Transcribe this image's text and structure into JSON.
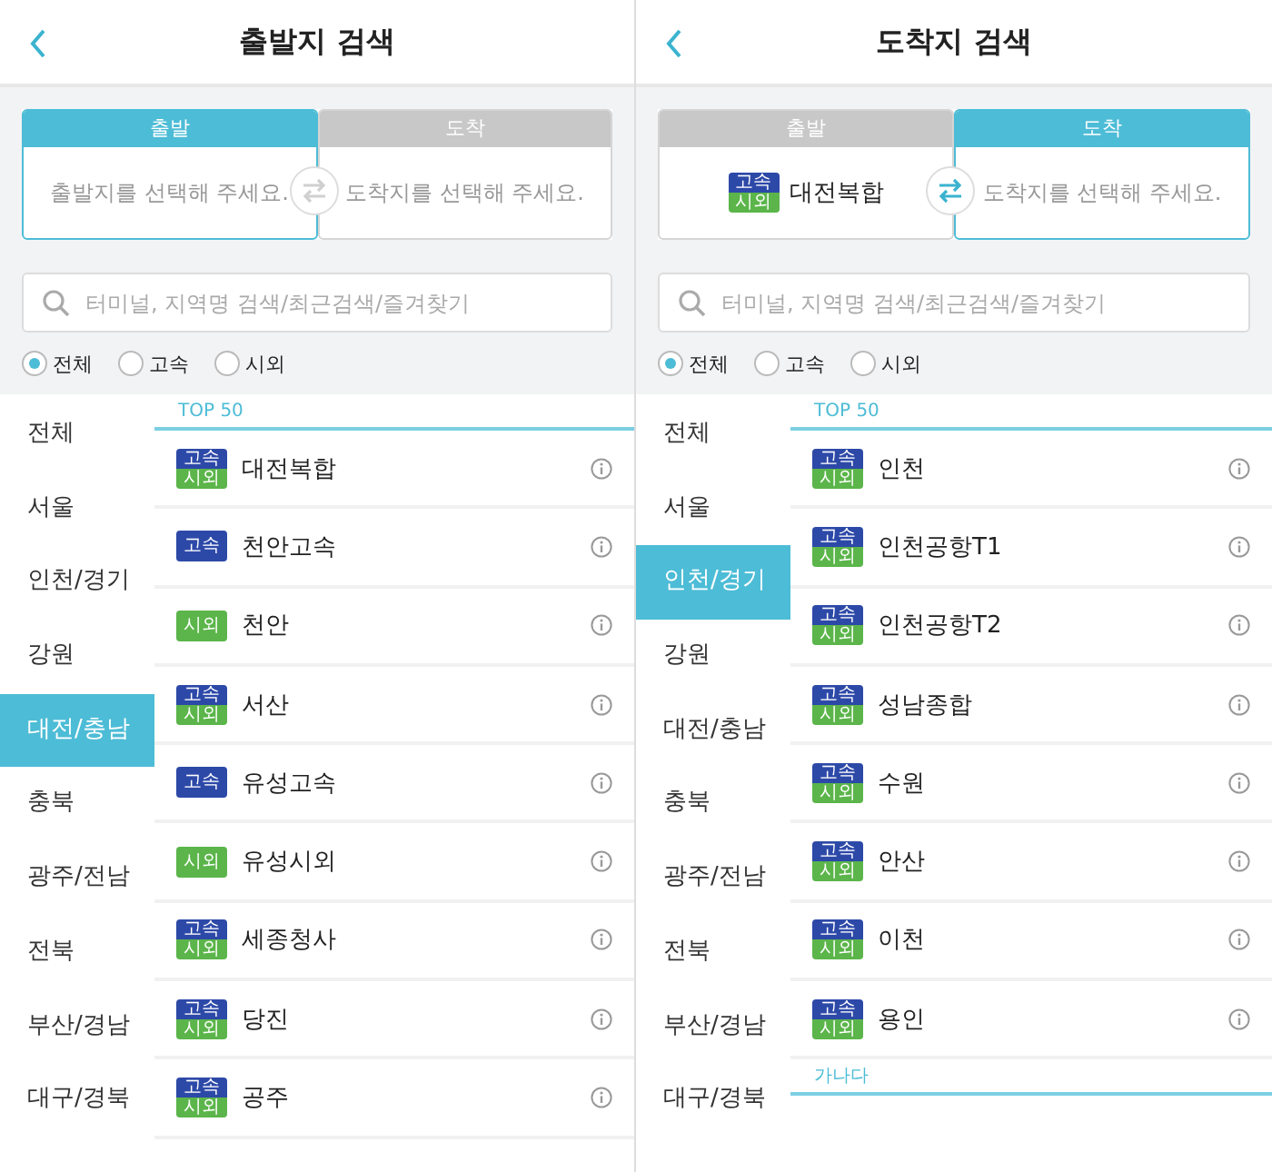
{
  "screens": [
    {
      "title": "출발지 검색",
      "swap_active": false,
      "slots": [
        {
          "header": "출발",
          "selected": true,
          "placeholder": "출발지를 선택해 주세요."
        },
        {
          "header": "도착",
          "selected": false,
          "placeholder": "도착지를 선택해 주세요."
        }
      ],
      "search": {
        "placeholder": "터미널, 지역명 검색/최근검색/즐겨찾기"
      },
      "filters": [
        {
          "label": "전체",
          "selected": true
        },
        {
          "label": "고속",
          "selected": false
        },
        {
          "label": "시외",
          "selected": false
        }
      ],
      "regions": [
        {
          "label": "전체",
          "selected": false
        },
        {
          "label": "서울",
          "selected": false
        },
        {
          "label": "인천/경기",
          "selected": false
        },
        {
          "label": "강원",
          "selected": false
        },
        {
          "label": "대전/충남",
          "selected": true
        },
        {
          "label": "충북",
          "selected": false
        },
        {
          "label": "광주/전남",
          "selected": false
        },
        {
          "label": "전북",
          "selected": false
        },
        {
          "label": "부산/경남",
          "selected": false
        },
        {
          "label": "대구/경북",
          "selected": false
        }
      ],
      "sections": [
        {
          "title": "TOP 50",
          "items": [
            {
              "name": "대전복합",
              "badges": [
                {
                  "kind": "express",
                  "label": "고속"
                },
                {
                  "kind": "intercity",
                  "label": "시외"
                }
              ]
            },
            {
              "name": "천안고속",
              "badges": [
                {
                  "kind": "express",
                  "label": "고속"
                }
              ]
            },
            {
              "name": "천안",
              "badges": [
                {
                  "kind": "intercity",
                  "label": "시외"
                }
              ]
            },
            {
              "name": "서산",
              "badges": [
                {
                  "kind": "express",
                  "label": "고속"
                },
                {
                  "kind": "intercity",
                  "label": "시외"
                }
              ]
            },
            {
              "name": "유성고속",
              "badges": [
                {
                  "kind": "express",
                  "label": "고속"
                }
              ]
            },
            {
              "name": "유성시외",
              "badges": [
                {
                  "kind": "intercity",
                  "label": "시외"
                }
              ]
            },
            {
              "name": "세종청사",
              "badges": [
                {
                  "kind": "express",
                  "label": "고속"
                },
                {
                  "kind": "intercity",
                  "label": "시외"
                }
              ]
            },
            {
              "name": "당진",
              "badges": [
                {
                  "kind": "express",
                  "label": "고속"
                },
                {
                  "kind": "intercity",
                  "label": "시외"
                }
              ]
            },
            {
              "name": "공주",
              "badges": [
                {
                  "kind": "express",
                  "label": "고속"
                },
                {
                  "kind": "intercity",
                  "label": "시외"
                }
              ]
            }
          ]
        }
      ]
    },
    {
      "title": "도착지 검색",
      "swap_active": true,
      "slots": [
        {
          "header": "출발",
          "selected": false,
          "value": "대전복합",
          "badges": [
            {
              "kind": "express",
              "label": "고속"
            },
            {
              "kind": "intercity",
              "label": "시외"
            }
          ]
        },
        {
          "header": "도착",
          "selected": true,
          "placeholder": "도착지를 선택해 주세요."
        }
      ],
      "search": {
        "placeholder": "터미널, 지역명 검색/최근검색/즐겨찾기"
      },
      "filters": [
        {
          "label": "전체",
          "selected": true
        },
        {
          "label": "고속",
          "selected": false
        },
        {
          "label": "시외",
          "selected": false
        }
      ],
      "regions": [
        {
          "label": "전체",
          "selected": false
        },
        {
          "label": "서울",
          "selected": false
        },
        {
          "label": "인천/경기",
          "selected": true
        },
        {
          "label": "강원",
          "selected": false
        },
        {
          "label": "대전/충남",
          "selected": false
        },
        {
          "label": "충북",
          "selected": false
        },
        {
          "label": "광주/전남",
          "selected": false
        },
        {
          "label": "전북",
          "selected": false
        },
        {
          "label": "부산/경남",
          "selected": false
        },
        {
          "label": "대구/경북",
          "selected": false
        }
      ],
      "sections": [
        {
          "title": "TOP 50",
          "items": [
            {
              "name": "인천",
              "badges": [
                {
                  "kind": "express",
                  "label": "고속"
                },
                {
                  "kind": "intercity",
                  "label": "시외"
                }
              ]
            },
            {
              "name": "인천공항T1",
              "badges": [
                {
                  "kind": "express",
                  "label": "고속"
                },
                {
                  "kind": "intercity",
                  "label": "시외"
                }
              ]
            },
            {
              "name": "인천공항T2",
              "badges": [
                {
                  "kind": "express",
                  "label": "고속"
                },
                {
                  "kind": "intercity",
                  "label": "시외"
                }
              ]
            },
            {
              "name": "성남종합",
              "badges": [
                {
                  "kind": "express",
                  "label": "고속"
                },
                {
                  "kind": "intercity",
                  "label": "시외"
                }
              ]
            },
            {
              "name": "수원",
              "badges": [
                {
                  "kind": "express",
                  "label": "고속"
                },
                {
                  "kind": "intercity",
                  "label": "시외"
                }
              ]
            },
            {
              "name": "안산",
              "badges": [
                {
                  "kind": "express",
                  "label": "고속"
                },
                {
                  "kind": "intercity",
                  "label": "시외"
                }
              ]
            },
            {
              "name": "이천",
              "badges": [
                {
                  "kind": "express",
                  "label": "고속"
                },
                {
                  "kind": "intercity",
                  "label": "시외"
                }
              ]
            },
            {
              "name": "용인",
              "badges": [
                {
                  "kind": "express",
                  "label": "고속"
                },
                {
                  "kind": "intercity",
                  "label": "시외"
                }
              ]
            }
          ]
        },
        {
          "title": "가나다"
        }
      ]
    }
  ]
}
